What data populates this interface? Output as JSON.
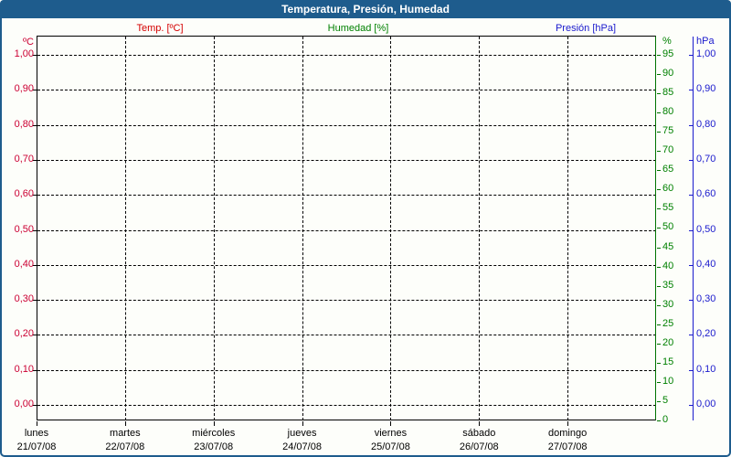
{
  "window": {
    "title": "Temperatura, Presión, Humedad"
  },
  "legend": [
    {
      "label": "Temp. [ºC]",
      "color": "#d40000"
    },
    {
      "label": "Humedad [%]",
      "color": "#008000"
    },
    {
      "label": "Presión [hPa]",
      "color": "#1a1acd"
    }
  ],
  "chart_data": {
    "type": "line",
    "title": "Temperatura, Presión, Humedad",
    "grid": true,
    "x_days": [
      {
        "day": "lunes",
        "date": "21/07/08"
      },
      {
        "day": "martes",
        "date": "22/07/08"
      },
      {
        "day": "miércoles",
        "date": "23/07/08"
      },
      {
        "day": "jueves",
        "date": "24/07/08"
      },
      {
        "day": "viernes",
        "date": "25/07/08"
      },
      {
        "day": "sábado",
        "date": "26/07/08"
      },
      {
        "day": "domingo",
        "date": "27/07/08"
      }
    ],
    "axes": {
      "temp": {
        "unit": "ºC",
        "side": "left",
        "color": "#cc0033",
        "ticks": [
          "1,00",
          "0,90",
          "0,80",
          "0,70",
          "0,60",
          "0,50",
          "0,40",
          "0,30",
          "0,20",
          "0,10",
          "0,00"
        ],
        "range_shown": [
          0.0,
          1.0
        ]
      },
      "humidity": {
        "unit": "%",
        "side": "right-inner",
        "color": "#008000",
        "ticks": [
          "95",
          "90",
          "85",
          "80",
          "75",
          "70",
          "65",
          "60",
          "55",
          "50",
          "45",
          "40",
          "35",
          "30",
          "25",
          "20",
          "15",
          "10",
          "5",
          "0"
        ],
        "range_shown": [
          0,
          100
        ]
      },
      "pressure": {
        "unit": "hPa",
        "side": "right-outer",
        "color": "#1a1acd",
        "ticks": [
          "1,00",
          "0,90",
          "0,80",
          "0,70",
          "0,60",
          "0,50",
          "0,40",
          "0,30",
          "0,20",
          "0,10",
          "0,00"
        ],
        "range_shown": [
          0.0,
          1.0
        ]
      }
    },
    "series": [
      {
        "name": "Temp. [ºC]",
        "axis": "temp",
        "values": []
      },
      {
        "name": "Humedad [%]",
        "axis": "humidity",
        "values": []
      },
      {
        "name": "Presión [hPa]",
        "axis": "pressure",
        "values": []
      }
    ]
  }
}
